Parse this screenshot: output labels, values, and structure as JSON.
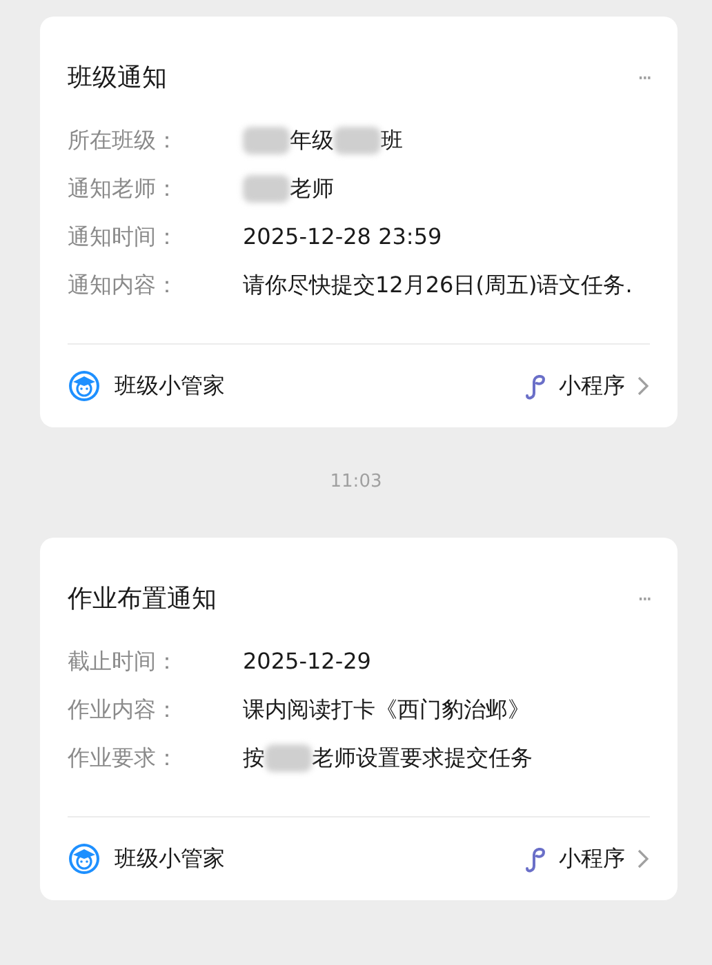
{
  "messages": [
    {
      "kind": "card",
      "title": "班级通知",
      "more": "···",
      "fields": [
        {
          "label": "所在班级：",
          "parts": [
            {
              "kind": "redacted"
            },
            {
              "kind": "text",
              "text": "年级"
            },
            {
              "kind": "redacted"
            },
            {
              "kind": "text",
              "text": "班"
            }
          ]
        },
        {
          "label": "通知老师：",
          "parts": [
            {
              "kind": "redacted"
            },
            {
              "kind": "text",
              "text": "老师"
            }
          ]
        },
        {
          "label": "通知时间：",
          "parts": [
            {
              "kind": "text",
              "text": "2025-12-28 23:59"
            }
          ]
        },
        {
          "label": "通知内容：",
          "parts": [
            {
              "kind": "text",
              "text": "请你尽快提交12月26日(周五)语文任务."
            }
          ]
        }
      ],
      "source": "班级小管家",
      "app_label": "小程序"
    },
    {
      "kind": "time",
      "text": "11:03"
    },
    {
      "kind": "card",
      "title": "作业布置通知",
      "more": "···",
      "fields": [
        {
          "label": "截止时间：",
          "parts": [
            {
              "kind": "text",
              "text": "2025-12-29"
            }
          ]
        },
        {
          "label": "作业内容：",
          "parts": [
            {
              "kind": "text",
              "text": "课内阅读打卡《西门豹治邺》"
            }
          ]
        },
        {
          "label": "作业要求：",
          "parts": [
            {
              "kind": "text",
              "text": "按"
            },
            {
              "kind": "redacted"
            },
            {
              "kind": "text",
              "text": "老师设置要求提交任务"
            }
          ]
        }
      ],
      "source": "班级小管家",
      "app_label": "小程序"
    }
  ]
}
